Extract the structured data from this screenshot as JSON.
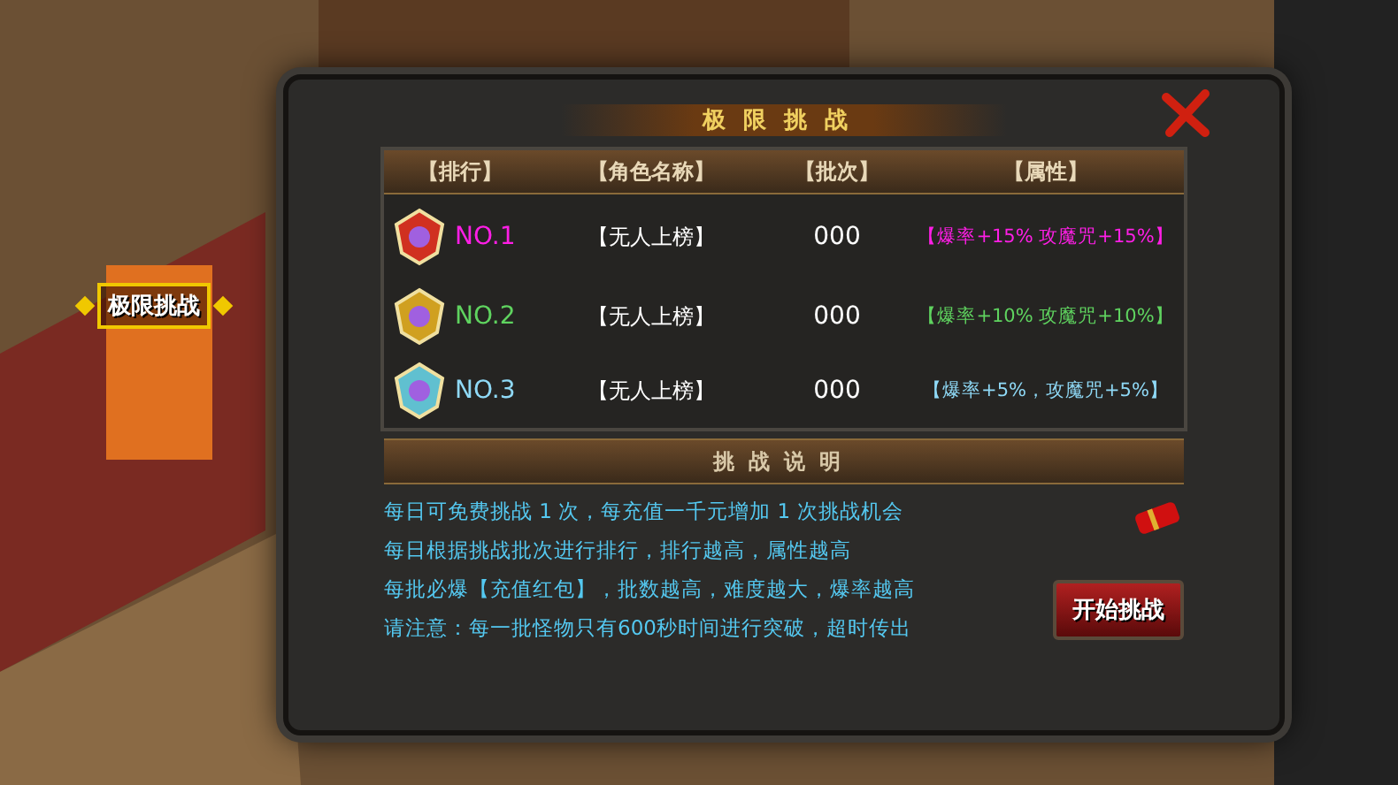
{
  "npc_label": "极限挑战",
  "dialog": {
    "title": "极限挑战",
    "table": {
      "columns": [
        "【排行】",
        "【角色名称】",
        "【批次】",
        "【属性】"
      ],
      "rows": [
        {
          "rank": "NO.1",
          "name": "【无人上榜】",
          "batch": "000",
          "attribute": "【爆率+15% 攻魔咒+15%】",
          "color": "#ff1ee6"
        },
        {
          "rank": "NO.2",
          "name": "【无人上榜】",
          "batch": "000",
          "attribute": "【爆率+10% 攻魔咒+10%】",
          "color": "#5fd35f"
        },
        {
          "rank": "NO.3",
          "name": "【无人上榜】",
          "batch": "000",
          "attribute": "【爆率+5%，攻魔咒+5%】",
          "color": "#8fd9f6"
        }
      ]
    },
    "section_title": "挑战说明",
    "lines": [
      "每日可免费挑战 1 次，每充值一千元增加 1 次挑战机会",
      "每日根据挑战批次进行排行，排行越高，属性越高",
      "每批必爆【充值红包】，批数越高，难度越大，爆率越高",
      "请注意：每一批怪物只有600秒时间进行突破，超时传出"
    ],
    "button": "开始挑战"
  }
}
